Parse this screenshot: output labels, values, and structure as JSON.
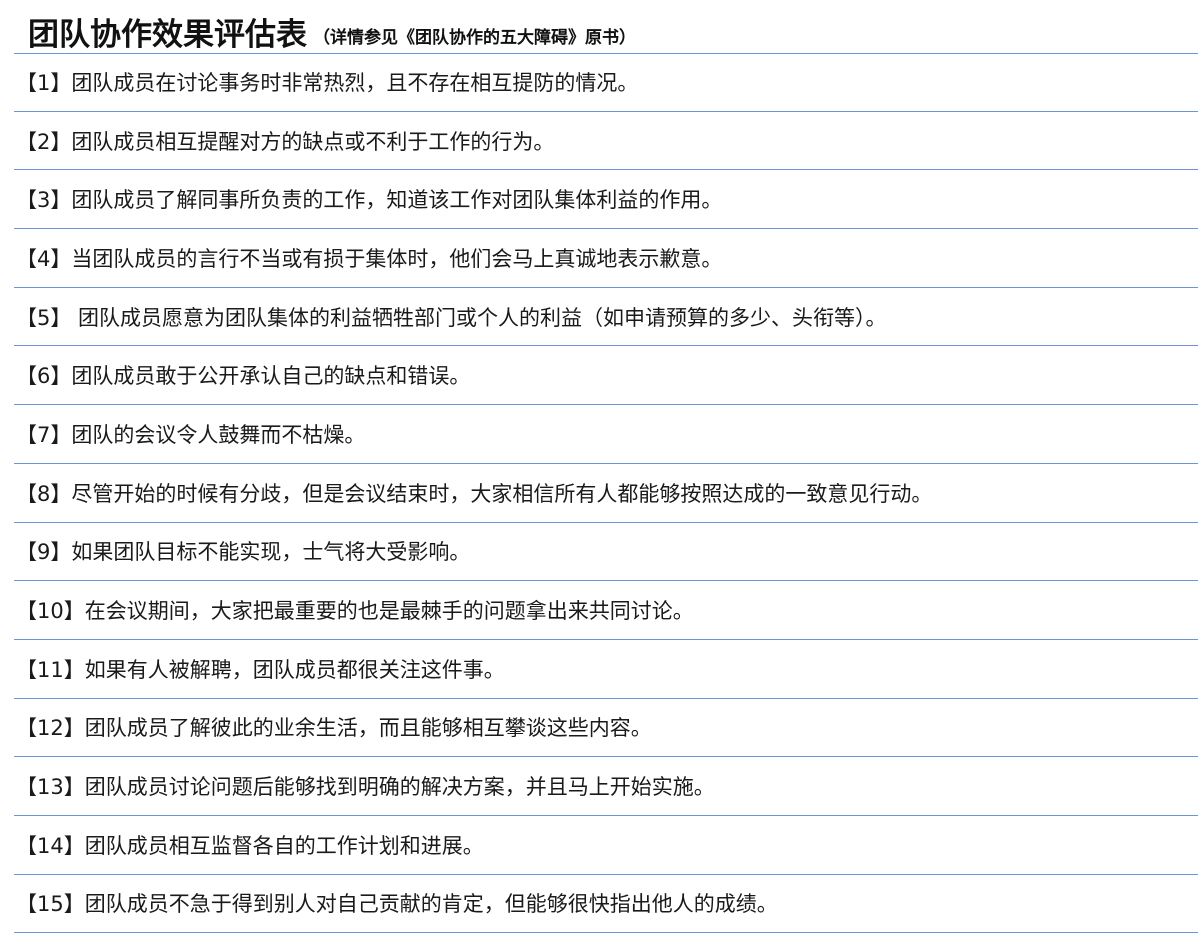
{
  "header": {
    "title": "团队协作效果评估表",
    "subtitle": "（详情参见《团队协作的五大障碍》原书）"
  },
  "items": [
    {
      "no": "【1】",
      "text": "团队成员在讨论事务时非常热烈，且不存在相互提防的情况。"
    },
    {
      "no": "【2】",
      "text": "团队成员相互提醒对方的缺点或不利于工作的行为。"
    },
    {
      "no": "【3】",
      "text": "团队成员了解同事所负责的工作，知道该工作对团队集体利益的作用。"
    },
    {
      "no": "【4】",
      "text": "当团队成员的言行不当或有损于集体时，他们会马上真诚地表示歉意。"
    },
    {
      "no": "【5】",
      "text": " 团队成员愿意为团队集体的利益牺牲部门或个人的利益（如申请预算的多少、头衔等）。"
    },
    {
      "no": "【6】",
      "text": "团队成员敢于公开承认自己的缺点和错误。"
    },
    {
      "no": "【7】",
      "text": "团队的会议令人鼓舞而不枯燥。"
    },
    {
      "no": "【8】",
      "text": "尽管开始的时候有分歧，但是会议结束时，大家相信所有人都能够按照达成的一致意见行动。"
    },
    {
      "no": "【9】",
      "text": "如果团队目标不能实现，士气将大受影响。"
    },
    {
      "no": "【10】",
      "text": "在会议期间，大家把最重要的也是最棘手的问题拿出来共同讨论。"
    },
    {
      "no": "【11】",
      "text": "如果有人被解聘，团队成员都很关注这件事。"
    },
    {
      "no": "【12】",
      "text": "团队成员了解彼此的业余生活，而且能够相互攀谈这些内容。"
    },
    {
      "no": "【13】",
      "text": "团队成员讨论问题后能够找到明确的解决方案，并且马上开始实施。"
    },
    {
      "no": "【14】",
      "text": "团队成员相互监督各自的工作计划和进展。"
    },
    {
      "no": "【15】",
      "text": "团队成员不急于得到别人对自己贡献的肯定，但能够很快指出他人的成绩。"
    }
  ],
  "colors": {
    "rule_line": "#6f93d9",
    "text": "#1a1a1a",
    "background": "#ffffff"
  }
}
